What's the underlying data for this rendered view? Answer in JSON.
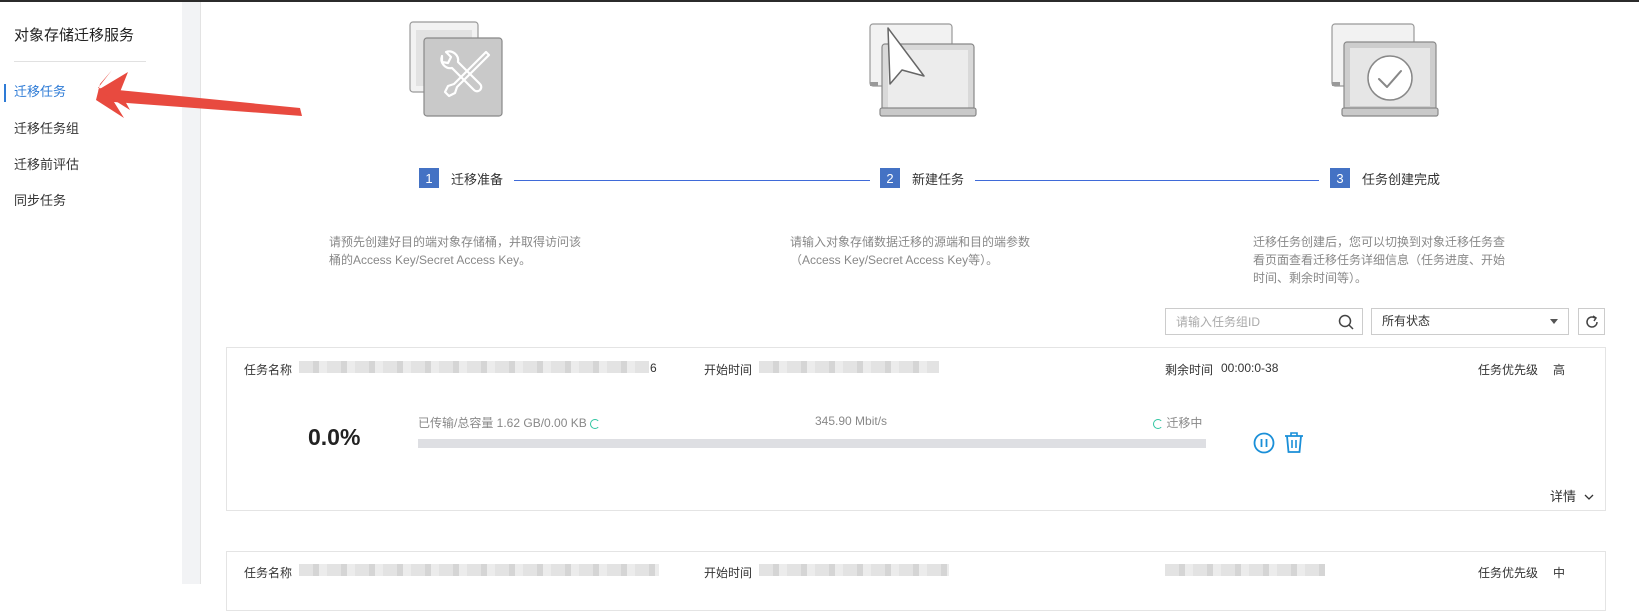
{
  "sidebar": {
    "title": "对象存储迁移服务",
    "items": [
      {
        "label": "迁移任务",
        "active": true
      },
      {
        "label": "迁移任务组",
        "active": false
      },
      {
        "label": "迁移前评估",
        "active": false
      },
      {
        "label": "同步任务",
        "active": false
      }
    ]
  },
  "steps": [
    {
      "num": "1",
      "label": "迁移准备",
      "desc": [
        "请预先创建好目的端对象存储桶，并取得访问该",
        "桶的Access Key/Secret Access Key。"
      ]
    },
    {
      "num": "2",
      "label": "新建任务",
      "desc": [
        "请输入对象存储数据迁移的源端和目的端参数",
        "（Access Key/Secret Access Key等）。"
      ]
    },
    {
      "num": "3",
      "label": "任务创建完成",
      "desc": [
        "迁移任务创建后，您可以切换到对象迁移任务查",
        "看页面查看迁移任务详细信息（任务进度、开始",
        "时间、剩余时间等）。"
      ]
    }
  ],
  "toolbar": {
    "search_placeholder": "请输入任务组ID",
    "status_filter": "所有状态"
  },
  "tasks": [
    {
      "name_label": "任务名称",
      "name_suffix": "6",
      "start_label": "开始时间",
      "remain_label": "剩余时间",
      "remain_value": "00:00:0-38",
      "priority_label": "任务优先级",
      "priority_value": "高",
      "percent": "0.0%",
      "progress_fraction": 0.0,
      "transferred": "已传输/总容量 1.62 GB/0.00 KB",
      "speed": "345.90 Mbit/s",
      "status": "迁移中",
      "detail_label": "详情"
    },
    {
      "name_label": "任务名称",
      "start_label": "开始时间",
      "priority_label": "任务优先级",
      "priority_value": "中"
    }
  ],
  "colors": {
    "accent": "#2e7bd6",
    "step_badge": "#4472c4",
    "action_icon": "#1a8fd8",
    "annotation_arrow": "#e84a3f"
  }
}
